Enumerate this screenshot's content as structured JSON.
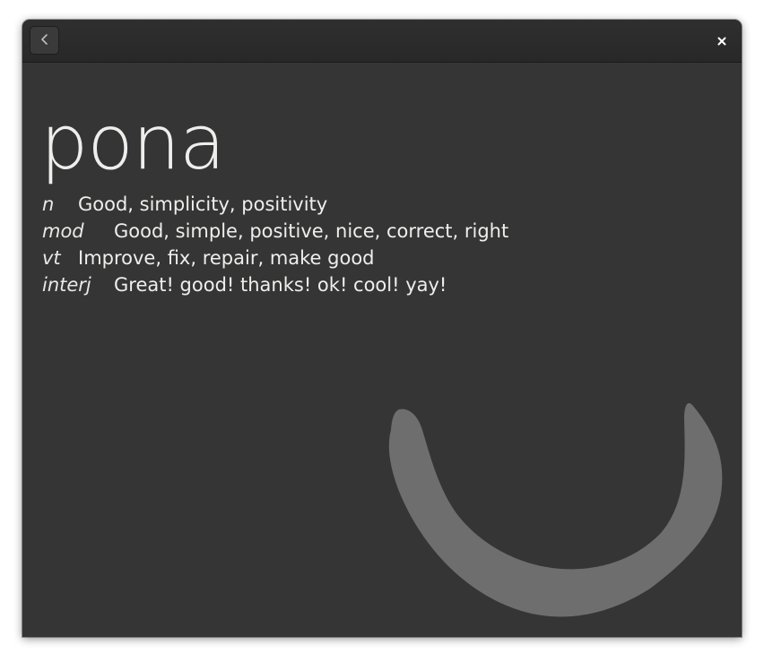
{
  "headerbar": {
    "back_icon": "go-previous-icon",
    "close_icon": "window-close-icon"
  },
  "entry": {
    "word": "pona",
    "definitions": [
      {
        "pos": "n",
        "text": "Good, simplicity, positivity"
      },
      {
        "pos": "mod",
        "text": "Good, simple, positive, nice, correct, right"
      },
      {
        "pos": "vt",
        "text": "Improve, fix, repair, make good"
      },
      {
        "pos": "interj",
        "text": "Great! good! thanks! ok! cool! yay!"
      }
    ],
    "glyph_icon": "pona-sitelen-glyph-icon",
    "glyph_color": "#6e6e6e"
  },
  "colors": {
    "window_bg": "#353535",
    "headerbar_bg": "#2b2b2b",
    "text": "#eeeeec"
  }
}
